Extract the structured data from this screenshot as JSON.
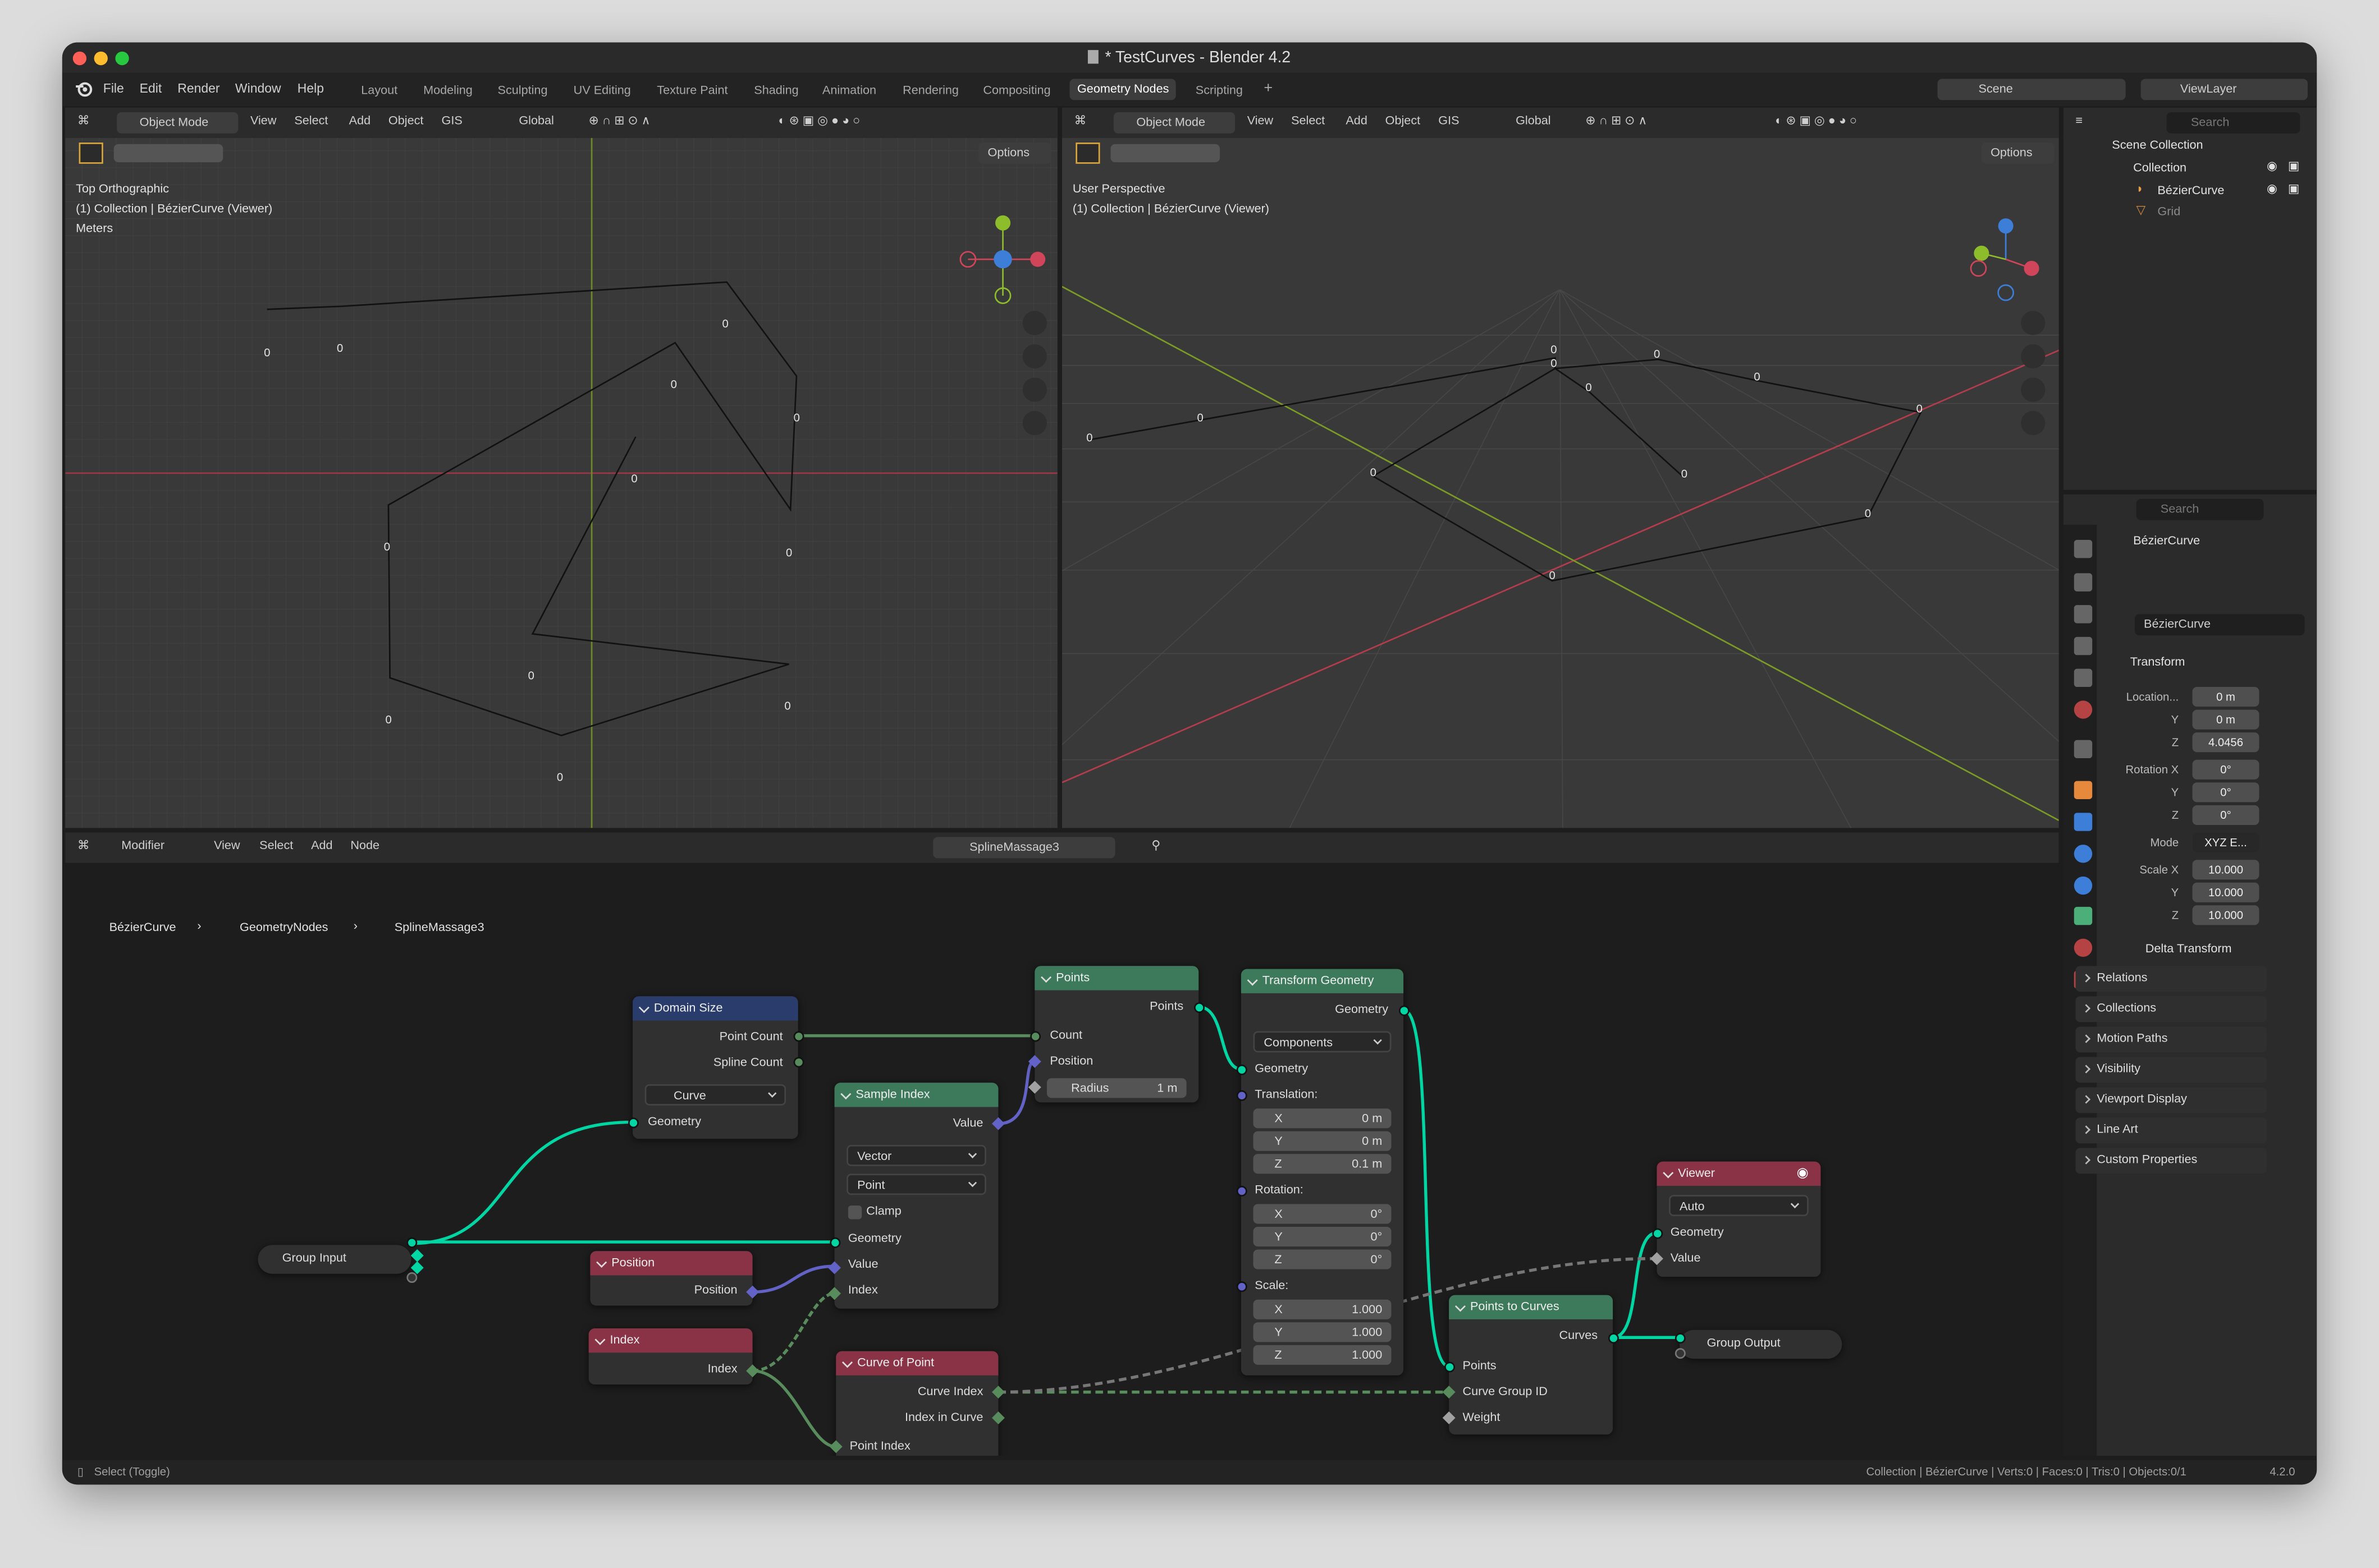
{
  "window": {
    "title": "* TestCurves - Blender 4.2"
  },
  "menu": {
    "file": "File",
    "edit": "Edit",
    "render": "Render",
    "window": "Window",
    "help": "Help"
  },
  "workspaces": [
    "Layout",
    "Modeling",
    "Sculpting",
    "UV Editing",
    "Texture Paint",
    "Shading",
    "Animation",
    "Rendering",
    "Compositing",
    "Geometry Nodes",
    "Scripting"
  ],
  "active_workspace": "Geometry Nodes",
  "scene": {
    "name": "Scene",
    "view_layer": "ViewLayer"
  },
  "viewport_left": {
    "mode": "Object Mode",
    "menus": [
      "View",
      "Select",
      "Add",
      "Object",
      "GIS"
    ],
    "orientation": "Global",
    "options": "Options",
    "view_name": "Top Orthographic",
    "collection": "(1) Collection | BézierCurve (Viewer)",
    "units": "Meters",
    "point_label": "0"
  },
  "viewport_right": {
    "mode": "Object Mode",
    "menus": [
      "View",
      "Select",
      "Add",
      "Object",
      "GIS"
    ],
    "orientation": "Global",
    "options": "Options",
    "view_name": "User Perspective",
    "collection": "(1) Collection | BézierCurve (Viewer)",
    "point_label": "0"
  },
  "outliner": {
    "search_placeholder": "Search",
    "scene_collection": "Scene Collection",
    "collection": "Collection",
    "items": [
      "BézierCurve",
      "Grid"
    ]
  },
  "properties": {
    "search_placeholder": "Search",
    "object_name": "BézierCurve",
    "data_name": "BézierCurve",
    "transform_label": "Transform",
    "location_label": "Location...",
    "location": [
      "0 m",
      "0 m",
      "4.0456"
    ],
    "rotation_label": "Rotation X",
    "rotation": [
      "0°",
      "0°",
      "0°"
    ],
    "mode_label": "Mode",
    "mode": "XYZ E...",
    "scale_label": "Scale X",
    "scale": [
      "10.000",
      "10.000",
      "10.000"
    ],
    "axis": [
      "Y",
      "Z"
    ],
    "delta": "Delta Transform",
    "sections": [
      "Relations",
      "Collections",
      "Motion Paths",
      "Visibility",
      "Viewport Display",
      "Line Art",
      "Custom Properties"
    ]
  },
  "node_editor": {
    "type": "Modifier",
    "menus": [
      "View",
      "Select",
      "Add",
      "Node"
    ],
    "node_group": "SplineMassage3",
    "breadcrumb": [
      "BézierCurve",
      "GeometryNodes",
      "SplineMassage3"
    ]
  },
  "nodes": {
    "domain_size": {
      "title": "Domain Size",
      "out1": "Point Count",
      "out2": "Spline Count",
      "domain": "Curve",
      "in": "Geometry"
    },
    "points": {
      "title": "Points",
      "out": "Points",
      "count": "Count",
      "position": "Position",
      "radius_label": "Radius",
      "radius": "1 m"
    },
    "transform": {
      "title": "Transform Geometry",
      "out": "Geometry",
      "mode": "Components",
      "in": "Geometry",
      "translation": "Translation:",
      "t": [
        "0 m",
        "0 m",
        "0.1 m"
      ],
      "rotation": "Rotation:",
      "r": [
        "0°",
        "0°",
        "0°"
      ],
      "scale": "Scale:",
      "s": [
        "1.000",
        "1.000",
        "1.000"
      ],
      "axes": [
        "X",
        "Y",
        "Z"
      ]
    },
    "sample_index": {
      "title": "Sample Index",
      "out": "Value",
      "type": "Vector",
      "domain": "Point",
      "clamp": "Clamp",
      "geometry": "Geometry",
      "value": "Value",
      "index": "Index"
    },
    "group_input": {
      "title": "Group Input"
    },
    "position": {
      "title": "Position",
      "out": "Position"
    },
    "index": {
      "title": "Index",
      "out": "Index"
    },
    "curve_of_point": {
      "title": "Curve of Point",
      "out1": "Curve Index",
      "out2": "Index in Curve",
      "in": "Point Index"
    },
    "points_to_curves": {
      "title": "Points to Curves",
      "out": "Curves",
      "in1": "Points",
      "in2": "Curve Group ID",
      "in3": "Weight"
    },
    "viewer": {
      "title": "Viewer",
      "domain": "Auto",
      "in1": "Geometry",
      "in2": "Value"
    },
    "group_output": {
      "title": "Group Output"
    }
  },
  "status": {
    "left": "Select (Toggle)",
    "right": "Collection | BézierCurve | Verts:0 | Faces:0 | Tris:0 | Objects:0/1",
    "version": "4.2.0"
  },
  "colors": {
    "geometry": "#00d6a3",
    "vector": "#6363c7",
    "integer": "#598c5c",
    "header_geo": "#3d7a5c",
    "header_input": "#8a3346",
    "header_util": "#2a3c6b",
    "x_axis": "#d1455a",
    "y_axis": "#8ebd2c",
    "z_axis": "#3d7fd8"
  }
}
